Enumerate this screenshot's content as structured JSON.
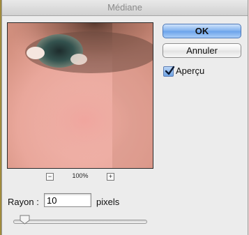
{
  "window": {
    "title": "Médiane"
  },
  "preview": {
    "zoom_level": "100%",
    "zoom_out": "−",
    "zoom_in": "+"
  },
  "buttons": {
    "ok_label": "OK",
    "cancel_label": "Annuler"
  },
  "options": {
    "preview_label": "Aperçu",
    "preview_checked": true
  },
  "radius": {
    "label": "Rayon :",
    "value": "10",
    "unit": "pixels",
    "slider_fraction": 0.05
  },
  "colors": {
    "ok_button": "#7fb0ee",
    "checkbox": "#6ea3e4",
    "dialog_bg": "#ececec"
  }
}
